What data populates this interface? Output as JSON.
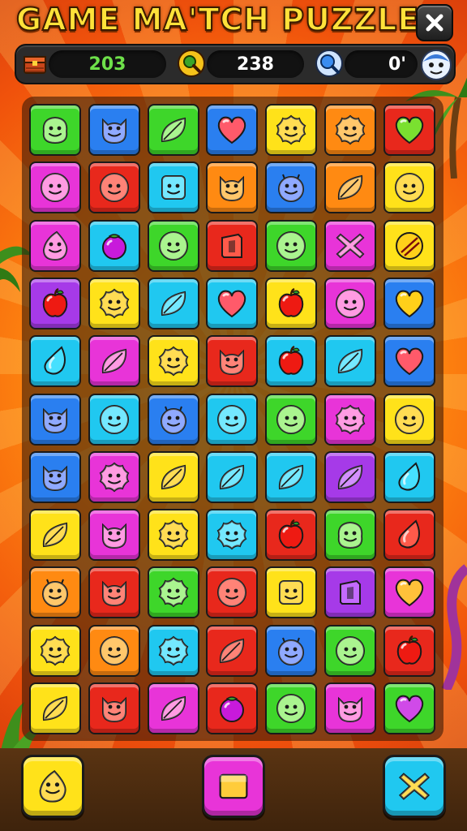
{
  "header": {
    "title": "GAME  MA'TCH PUZZLE",
    "close_icon": "close-icon"
  },
  "stats": {
    "moves": "203",
    "score": "238",
    "time": "0'",
    "icons": [
      "treasure-chest-icon",
      "search-icon",
      "magnifier-icon",
      "character-avatar-icon"
    ]
  },
  "colors": {
    "green": "#3ed62a",
    "blue": "#2a7ff0",
    "cyan": "#20c8f0",
    "red": "#e8281c",
    "yellow": "#ffe21a",
    "orange": "#ff8a12",
    "purple": "#a63ae8",
    "magenta": "#e834d8"
  },
  "board": {
    "rows": 11,
    "cols": 7,
    "tiles": [
      [
        [
          "green",
          "blob-face-icon"
        ],
        [
          "blue",
          "cat-face-icon"
        ],
        [
          "green",
          "leaf-icon"
        ],
        [
          "blue",
          "heart-icon"
        ],
        [
          "yellow",
          "flower-face-icon"
        ],
        [
          "orange",
          "flower-face-icon"
        ],
        [
          "red",
          "heart-icon"
        ]
      ],
      [
        [
          "magenta",
          "smiley-icon"
        ],
        [
          "red",
          "smiley-icon"
        ],
        [
          "cyan",
          "box-face-icon"
        ],
        [
          "orange",
          "cat-face-icon"
        ],
        [
          "blue",
          "devil-face-icon"
        ],
        [
          "orange",
          "leaf-icon"
        ],
        [
          "yellow",
          "smiley-icon"
        ]
      ],
      [
        [
          "magenta",
          "drop-face-icon"
        ],
        [
          "cyan",
          "plum-icon"
        ],
        [
          "green",
          "smiley-icon"
        ],
        [
          "red",
          "block-icon"
        ],
        [
          "green",
          "smiley-icon"
        ],
        [
          "magenta",
          "x-icon"
        ],
        [
          "yellow",
          "ball-icon"
        ]
      ],
      [
        [
          "purple",
          "apple-icon"
        ],
        [
          "yellow",
          "flower-face-icon"
        ],
        [
          "cyan",
          "leaf-icon"
        ],
        [
          "cyan",
          "heart-icon"
        ],
        [
          "yellow",
          "apple-icon"
        ],
        [
          "magenta",
          "smiley-icon"
        ],
        [
          "blue",
          "heart-icon"
        ]
      ],
      [
        [
          "cyan",
          "drop-icon"
        ],
        [
          "magenta",
          "leaf-icon"
        ],
        [
          "yellow",
          "flower-face-icon"
        ],
        [
          "red",
          "cat-face-icon"
        ],
        [
          "cyan",
          "apple-icon"
        ],
        [
          "cyan",
          "leaf-icon"
        ],
        [
          "blue",
          "heart-icon"
        ]
      ],
      [
        [
          "blue",
          "cat-face-icon"
        ],
        [
          "cyan",
          "smiley-icon"
        ],
        [
          "blue",
          "devil-face-icon"
        ],
        [
          "cyan",
          "smiley-icon"
        ],
        [
          "green",
          "smiley-icon"
        ],
        [
          "magenta",
          "flower-face-icon"
        ],
        [
          "yellow",
          "smiley-icon"
        ]
      ],
      [
        [
          "blue",
          "cat-face-icon"
        ],
        [
          "magenta",
          "flower-face-icon"
        ],
        [
          "yellow",
          "leaf-icon"
        ],
        [
          "cyan",
          "leaf-icon"
        ],
        [
          "cyan",
          "leaf-icon"
        ],
        [
          "purple",
          "leaf-icon"
        ],
        [
          "cyan",
          "drop-icon"
        ]
      ],
      [
        [
          "yellow",
          "leaf-icon"
        ],
        [
          "magenta",
          "cat-face-icon"
        ],
        [
          "yellow",
          "flower-face-icon"
        ],
        [
          "cyan",
          "flower-face-icon"
        ],
        [
          "red",
          "apple-icon"
        ],
        [
          "green",
          "blob-face-icon"
        ],
        [
          "red",
          "drop-icon"
        ]
      ],
      [
        [
          "orange",
          "devil-face-icon"
        ],
        [
          "red",
          "cat-face-icon"
        ],
        [
          "green",
          "flower-face-icon"
        ],
        [
          "red",
          "smiley-icon"
        ],
        [
          "yellow",
          "box-face-icon"
        ],
        [
          "purple",
          "block-icon"
        ],
        [
          "magenta",
          "heart-icon"
        ]
      ],
      [
        [
          "yellow",
          "flower-face-icon"
        ],
        [
          "orange",
          "smiley-icon"
        ],
        [
          "cyan",
          "flower-face-icon"
        ],
        [
          "red",
          "leaf-icon"
        ],
        [
          "blue",
          "devil-face-icon"
        ],
        [
          "green",
          "smiley-icon"
        ],
        [
          "red",
          "apple-icon"
        ]
      ],
      [
        [
          "yellow",
          "leaf-icon"
        ],
        [
          "red",
          "cat-face-icon"
        ],
        [
          "magenta",
          "leaf-icon"
        ],
        [
          "red",
          "plum-icon"
        ],
        [
          "green",
          "smiley-icon"
        ],
        [
          "magenta",
          "cat-face-icon"
        ],
        [
          "green",
          "heart-icon"
        ]
      ]
    ]
  },
  "powerups": [
    {
      "color": "yellow",
      "icon": "drop-face-icon"
    },
    {
      "color": "magenta",
      "icon": "square-icon"
    },
    {
      "color": "cyan",
      "icon": "x-icon"
    }
  ]
}
